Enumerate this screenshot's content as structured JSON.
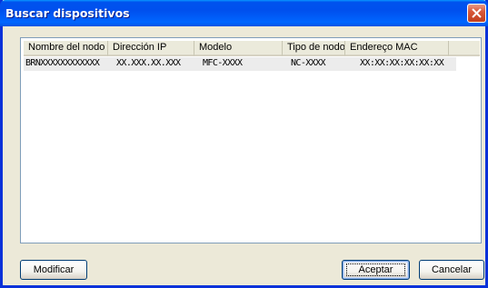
{
  "window": {
    "title": "Buscar dispositivos"
  },
  "list": {
    "columns": [
      "Nombre del nodo",
      "Dirección IP",
      "Modelo",
      "Tipo de nodo",
      "Endereço MAC"
    ],
    "rows": [
      [
        "BRNXXXXXXXXXXXX",
        "XX.XXX.XX.XXX",
        "MFC-XXXX",
        "NC-XXXX",
        "XX:XX:XX:XX:XX:XX"
      ]
    ]
  },
  "buttons": {
    "modify": "Modificar",
    "accept": "Aceptar",
    "cancel": "Cancelar"
  },
  "colors": {
    "titlebar": "#0054e3",
    "window_bg": "#ece9d8",
    "close_button": "#d8593a"
  },
  "icons": {
    "close": "close-icon"
  }
}
